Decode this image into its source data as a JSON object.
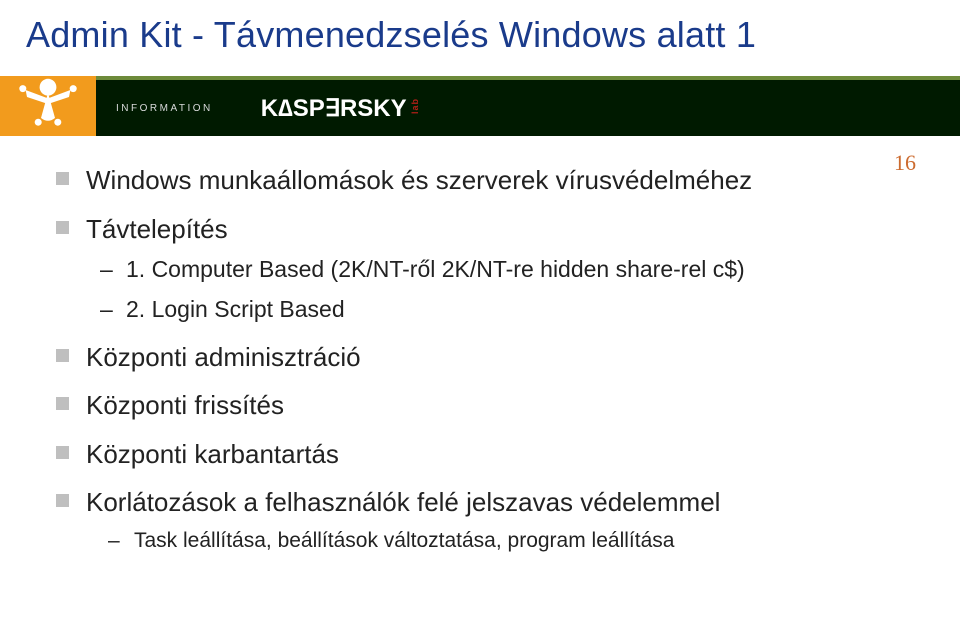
{
  "title": "Admin Kit - Távmenedzselés Windows alatt 1",
  "banner": {
    "info_label": "INFORMATION",
    "brand": "KASPERSKY",
    "brand_suffix": "lab"
  },
  "page_number": "16",
  "bullets": {
    "b1": "Windows munkaállomások és szerverek vírusvédelméhez",
    "b2": "Távtelepítés",
    "b2_sub1": "1. Computer Based (2K/NT-ről 2K/NT-re  hidden share-rel c$)",
    "b2_sub2": "2. Login Script Based",
    "b3": "Központi adminisztráció",
    "b4": "Központi frissítés",
    "b5": "Központi karbantartás",
    "b6": "Korlátozások a felhasználók felé jelszavas védelemmel",
    "b6_sub1": "Task leállítása, beállítások változtatása, program leállítása"
  }
}
